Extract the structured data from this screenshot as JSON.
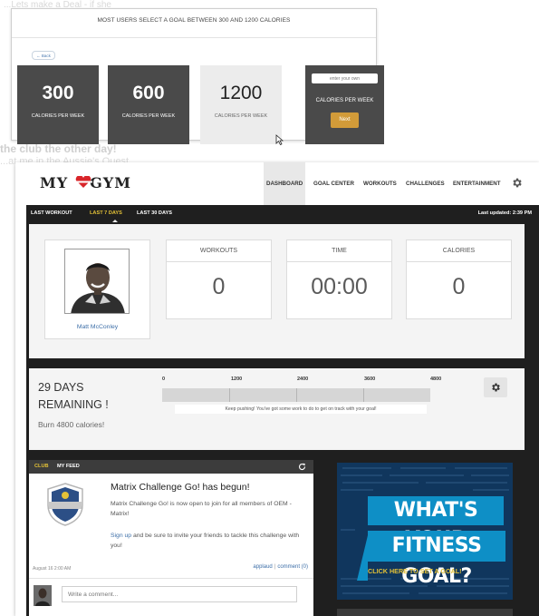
{
  "background": {
    "line1": "...Lets make a Deal - if she",
    "line2": "the club the other day!",
    "line3": "...at me in the Aussie's Quest"
  },
  "goal_panel": {
    "headline": "MOST USERS SELECT A GOAL BETWEEN 300 AND 1200 CALORIES",
    "back_label": "← Back",
    "options": [
      {
        "value": "300",
        "label": "CALORIES PER WEEK"
      },
      {
        "value": "600",
        "label": "CALORIES PER WEEK"
      },
      {
        "value": "1200",
        "label": "CALORIES PER WEEK"
      }
    ],
    "custom": {
      "placeholder": "enter your own",
      "label": "CALORIES PER WEEK",
      "button": "Next"
    }
  },
  "header": {
    "logo_left": "MY",
    "logo_right": "GYM",
    "nav": [
      "DASHBOARD",
      "GOAL CENTER",
      "WORKOUTS",
      "CHALLENGES",
      "ENTERTAINMENT"
    ],
    "active_nav": "DASHBOARD"
  },
  "subnav": {
    "tabs": [
      "LAST WORKOUT",
      "LAST 7 DAYS",
      "LAST 30 DAYS"
    ],
    "active_tab": "LAST 7 DAYS",
    "updated": "Last updated: 2:39 PM"
  },
  "profile": {
    "name": "Matt McConley"
  },
  "stats": [
    {
      "label": "WORKOUTS",
      "value": "0"
    },
    {
      "label": "TIME",
      "value": "00:00"
    },
    {
      "label": "CALORIES",
      "value": "0"
    }
  ],
  "progress": {
    "days_line1": "29 DAYS",
    "days_line2": "REMAINING !",
    "burn": "Burn 4800 calories!",
    "ticks": [
      "0",
      "1200",
      "2400",
      "3600",
      "4800"
    ],
    "fill_fraction": 0,
    "message": "Keep pushing! You've got some work to do to get on track with your goal!"
  },
  "feed": {
    "tabs": [
      "CLUB",
      "MY FEED"
    ],
    "active_tab": "CLUB",
    "post": {
      "title": "Matrix Challenge Go! has begun!",
      "body": "Matrix Challenge Go! is now open to join for all members of OEM - Matrix!",
      "signup_link": "Sign up",
      "body2": " and be sure to invite your friends to tackle this challenge with you!",
      "date": "August 16 2:00 AM",
      "applaud": "applaud",
      "comment": "comment (0)"
    },
    "comment_placeholder": "Write a comment..."
  },
  "promo": {
    "line1": "WHAT'S YOUR",
    "line2": "FITNESS GOAL?",
    "cta": "CLICK HERE TO SET A GOAL!"
  },
  "colors": {
    "accent": "#e3c137",
    "link": "#3d6fa8",
    "dark_tile": "#4a4a4a",
    "next_button": "#d29b39",
    "promo_blue": "#0e8fc6",
    "logo_heart": "#d9252a"
  },
  "icons": {
    "settings": "gear-icon",
    "refresh": "refresh-icon",
    "badge": "shield-badge-icon",
    "cursor": "mouse-cursor-icon"
  }
}
